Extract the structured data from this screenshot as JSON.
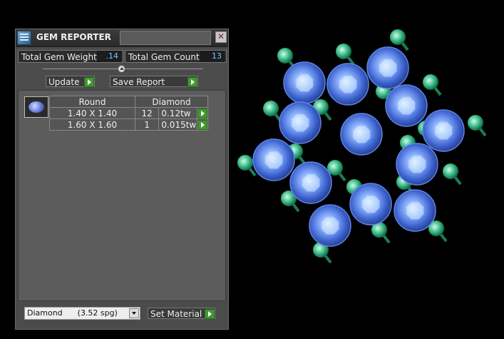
{
  "window": {
    "title": "GEM REPORTER"
  },
  "summary": {
    "weight_label": "Total Gem Weight",
    "weight_value": ".14",
    "count_label": "Total Gem Count",
    "count_value": "13"
  },
  "actions": {
    "update": "Update",
    "save_report": "Save Report"
  },
  "table": {
    "shape_header": "Round",
    "material_header": "Diamond",
    "rows": [
      {
        "size": "1.40 X 1.40",
        "count": "12",
        "weight": "0.12tw"
      },
      {
        "size": "1.60 X 1.60",
        "count": "1",
        "weight": "0.015tw"
      }
    ]
  },
  "material": {
    "selected": "Diamond      (3.52 spg)",
    "set_label": "Set Material"
  },
  "colors": {
    "accent_green": "#3f9a2e",
    "value_blue": "#6ad0ff",
    "gem_blue": "#3f6fd8",
    "prong_green": "#2faa7a"
  }
}
